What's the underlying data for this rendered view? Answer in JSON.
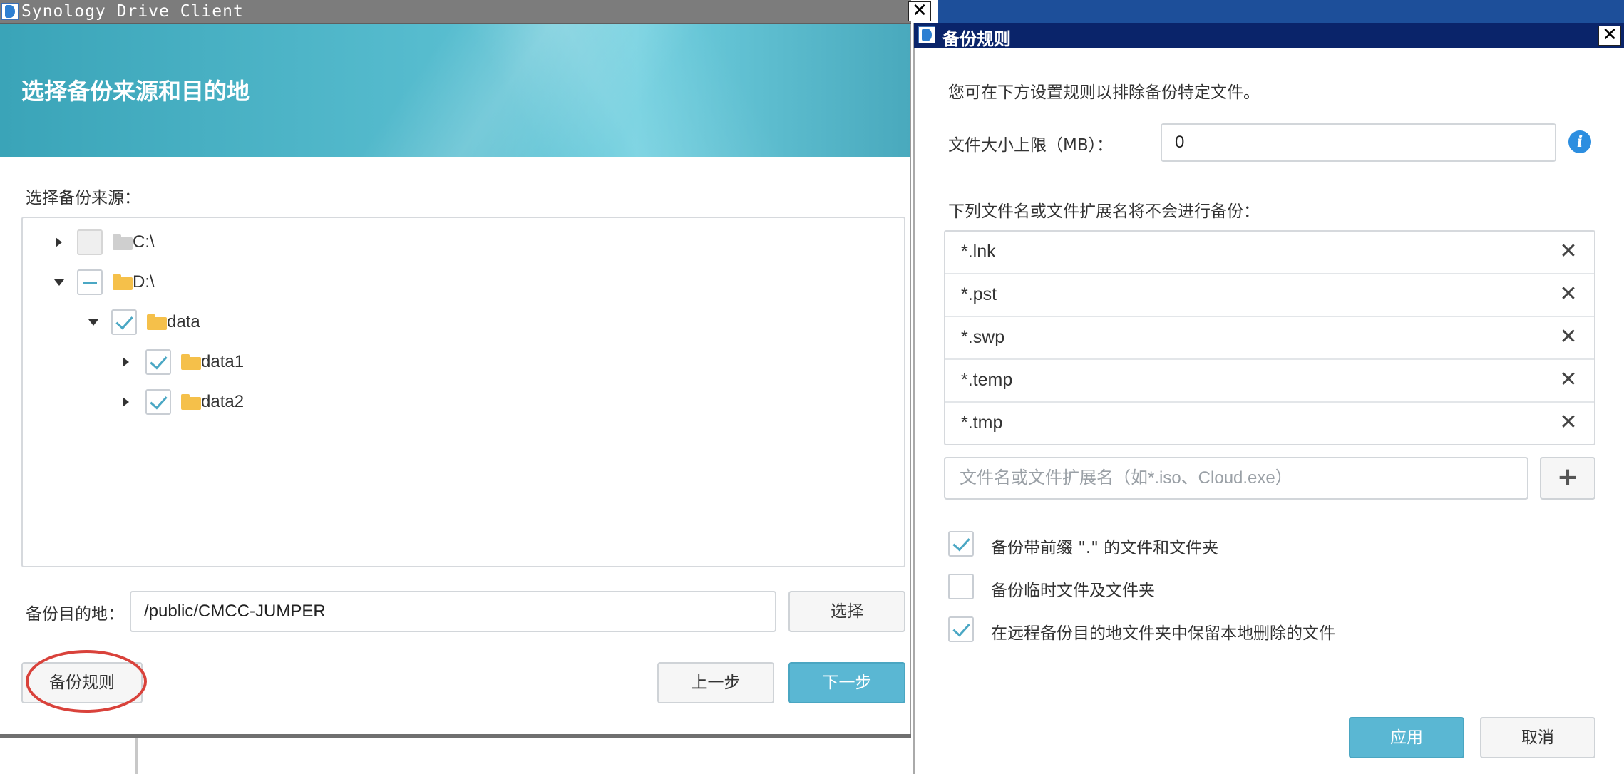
{
  "left_window": {
    "title": "Synology Drive Client",
    "close_glyph": "✕",
    "banner_title": "选择备份来源和目的地",
    "source_label": "选择备份来源：",
    "tree": [
      {
        "label": "C:\\",
        "state": "disabled",
        "expanded": false,
        "folder_color": "grey"
      },
      {
        "label": "D:\\",
        "state": "partial",
        "expanded": true,
        "folder_color": "yellow"
      },
      {
        "label": "data",
        "state": "checked",
        "expanded": true,
        "folder_color": "yellow"
      },
      {
        "label": "data1",
        "state": "checked",
        "expanded": false,
        "folder_color": "yellow"
      },
      {
        "label": "data2",
        "state": "checked",
        "expanded": false,
        "folder_color": "yellow"
      }
    ],
    "dest_label": "备份目的地：",
    "dest_value": "/public/CMCC-JUMPER",
    "select_button": "选择",
    "rules_button": "备份规则",
    "prev_button": "上一步",
    "next_button": "下一步"
  },
  "right_dialog": {
    "title": "备份规则",
    "close_glyph": "✕",
    "intro": "您可在下方设置规则以排除备份特定文件。",
    "size_label": "文件大小上限（MB）：",
    "size_value": "0",
    "info_glyph": "i",
    "exclude_label": "下列文件名或文件扩展名将不会进行备份：",
    "exclude_items": [
      "*.lnk",
      "*.pst",
      "*.swp",
      "*.temp",
      "*.tmp"
    ],
    "delete_glyph": "✕",
    "pattern_placeholder": "文件名或文件扩展名（如*.iso、Cloud.exe）",
    "add_glyph": "+",
    "options": [
      {
        "label": "备份带前缀 \".\" 的文件和文件夹",
        "checked": true
      },
      {
        "label": "备份临时文件及文件夹",
        "checked": false
      },
      {
        "label": "在远程备份目的地文件夹中保留本地删除的文件",
        "checked": true
      }
    ],
    "apply_button": "应用",
    "cancel_button": "取消"
  },
  "colors": {
    "accent": "#5ab7d3",
    "check": "#4aa7c4",
    "folder": "#f5c04a",
    "annotation_circle": "#d9423b",
    "dialog_titlebar": "#0a246a"
  }
}
